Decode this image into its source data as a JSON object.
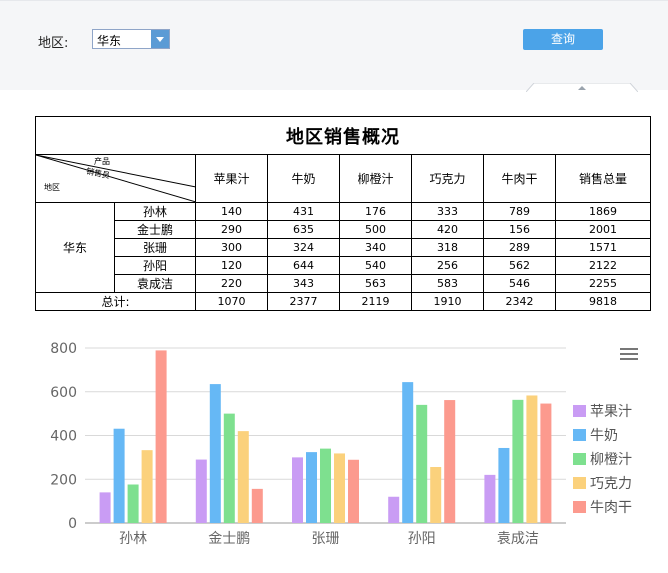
{
  "filter": {
    "region_label": "地区:",
    "region_value": "华东",
    "query_label": "查询"
  },
  "report": {
    "title": "地区销售概况",
    "corner_labels": {
      "product": "产品",
      "salesperson": "销售员",
      "region": "地区"
    },
    "columns": [
      "苹果汁",
      "牛奶",
      "柳橙汁",
      "巧克力",
      "牛肉干",
      "销售总量"
    ],
    "region": "华东",
    "rows": [
      {
        "name": "孙林",
        "values": [
          "140",
          "431",
          "176",
          "333",
          "789",
          "1869"
        ]
      },
      {
        "name": "金士鹏",
        "values": [
          "290",
          "635",
          "500",
          "420",
          "156",
          "2001"
        ]
      },
      {
        "name": "张珊",
        "values": [
          "300",
          "324",
          "340",
          "318",
          "289",
          "1571"
        ]
      },
      {
        "name": "孙阳",
        "values": [
          "120",
          "644",
          "540",
          "256",
          "562",
          "2122"
        ]
      },
      {
        "name": "袁成洁",
        "values": [
          "220",
          "343",
          "563",
          "583",
          "546",
          "2255"
        ]
      }
    ],
    "total_label": "总计:",
    "totals": [
      "1070",
      "2377",
      "2119",
      "1910",
      "2342",
      "9818"
    ]
  },
  "chart_data": {
    "type": "bar",
    "categories": [
      "孙林",
      "金士鹏",
      "张珊",
      "孙阳",
      "袁成洁"
    ],
    "series": [
      {
        "name": "苹果汁",
        "color": "#c99cf4",
        "values": [
          140,
          290,
          300,
          120,
          220
        ]
      },
      {
        "name": "牛奶",
        "color": "#66b8f5",
        "values": [
          431,
          635,
          324,
          644,
          343
        ]
      },
      {
        "name": "柳橙汁",
        "color": "#7ee08f",
        "values": [
          176,
          500,
          340,
          540,
          563
        ]
      },
      {
        "name": "巧克力",
        "color": "#fbd17c",
        "values": [
          333,
          420,
          318,
          256,
          583
        ]
      },
      {
        "name": "牛肉干",
        "color": "#fc9a8e",
        "values": [
          789,
          156,
          289,
          562,
          546
        ]
      }
    ],
    "yticks": [
      0,
      200,
      400,
      600,
      800
    ],
    "ylim": [
      0,
      800
    ],
    "grid": true,
    "legend_position": "right"
  }
}
